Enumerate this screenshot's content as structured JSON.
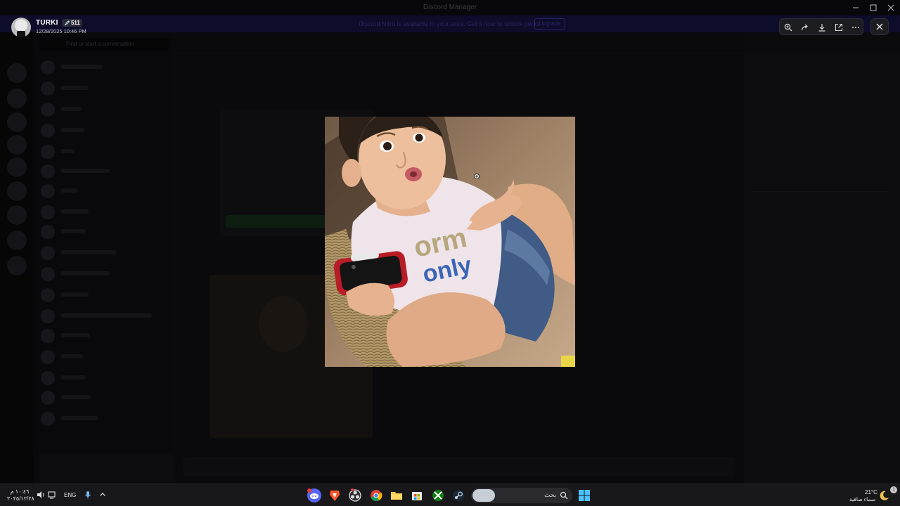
{
  "window": {
    "title": "Discord Manager"
  },
  "banner": {
    "text": "Discord Nitro is available in your area. Get it now to unlock perks",
    "button_label": "Upgrade"
  },
  "channels": {
    "search_placeholder": "Find or start a conversation"
  },
  "viewer": {
    "author": "TURKI",
    "badge": "💉511",
    "timestamp": "12/28/2025 10:46 PM",
    "toolbar_icons": [
      "zoom-in-icon",
      "forward-icon",
      "download-icon",
      "open-external-icon",
      "more-icon"
    ],
    "close_icon": "close-icon"
  },
  "photo": {
    "description_alt": ""
  },
  "taskbar": {
    "time": "١٠:٤٦ م",
    "date": "٢٠٢٥/١٢/٢٨",
    "language": "ENG",
    "search_label": "بحث",
    "weather_temp": "21°C",
    "weather_desc": "سماء صافية",
    "notification_count": "1",
    "apps": [
      "discord-app-icon",
      "brave-app-icon",
      "obs-app-icon",
      "chrome-app-icon",
      "file-explorer-app-icon",
      "store-app-icon",
      "xbox-app-icon",
      "steam-app-icon"
    ]
  },
  "colors": {
    "overlay_bg": "#070708",
    "toolbar_bg": "#1c1c21",
    "taskbar_bg": "#18181b"
  }
}
